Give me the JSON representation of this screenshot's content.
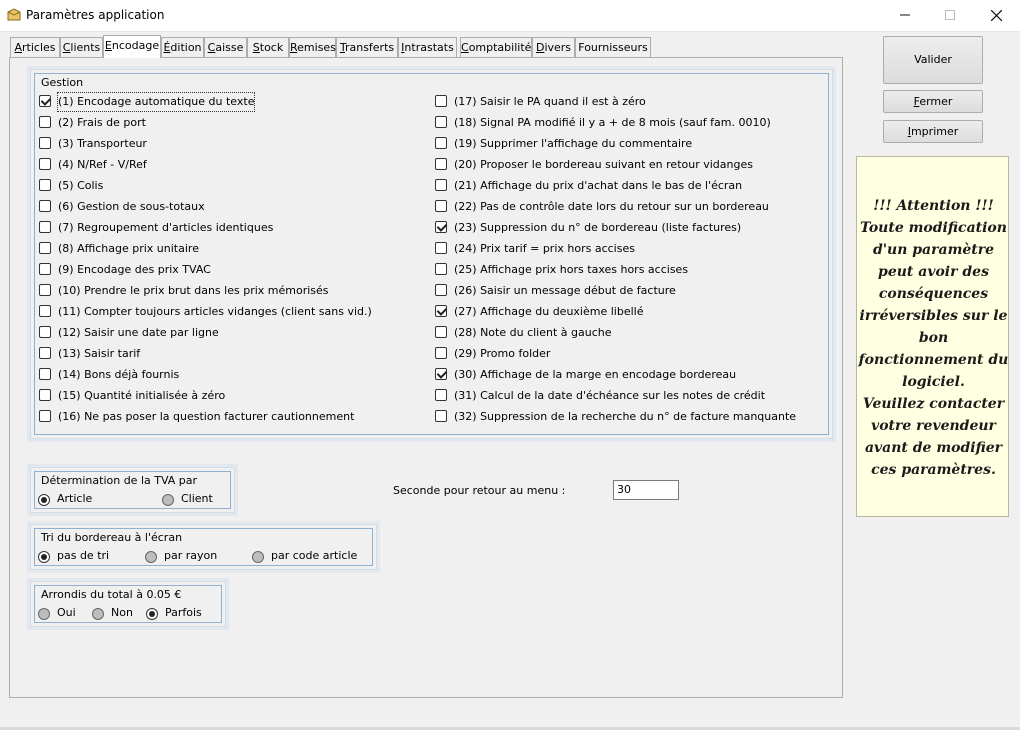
{
  "window": {
    "title": "Paramètres application"
  },
  "tabs": [
    {
      "pre": "",
      "u": "A",
      "post": "rticles"
    },
    {
      "pre": "",
      "u": "C",
      "post": "lients"
    },
    {
      "pre": "",
      "u": "E",
      "post": "ncodage"
    },
    {
      "pre": "",
      "u": "É",
      "post": "dition"
    },
    {
      "pre": "",
      "u": "C",
      "post": "aisse"
    },
    {
      "pre": "",
      "u": "S",
      "post": "tock"
    },
    {
      "pre": "",
      "u": "R",
      "post": "emises"
    },
    {
      "pre": "",
      "u": "T",
      "post": "ransferts"
    },
    {
      "pre": "",
      "u": "I",
      "post": "ntrastats"
    },
    {
      "pre": "",
      "u": "C",
      "post": "omptabilité"
    },
    {
      "pre": "",
      "u": "D",
      "post": "ivers"
    },
    {
      "pre": "",
      "u": "",
      "post": "Fournisseurs"
    }
  ],
  "gestion": {
    "title": "Gestion",
    "left": [
      {
        "label": "(1) Encodage automatique du texte",
        "checked": true
      },
      {
        "label": "(2) Frais de port",
        "checked": false
      },
      {
        "label": "(3) Transporteur",
        "checked": false
      },
      {
        "label": "(4) N/Ref - V/Ref",
        "checked": false
      },
      {
        "label": "(5) Colis",
        "checked": false
      },
      {
        "label": "(6) Gestion de sous-totaux",
        "checked": false
      },
      {
        "label": "(7) Regroupement d'articles identiques",
        "checked": false
      },
      {
        "label": "(8) Affichage prix unitaire",
        "checked": false
      },
      {
        "label": "(9) Encodage des prix TVAC",
        "checked": false
      },
      {
        "label": "(10) Prendre le prix brut dans les prix mémorisés",
        "checked": false
      },
      {
        "label": "(11) Compter toujours articles vidanges (client sans vid.)",
        "checked": false
      },
      {
        "label": "(12) Saisir une date par ligne",
        "checked": false
      },
      {
        "label": "(13) Saisir tarif",
        "checked": false
      },
      {
        "label": "(14) Bons déjà fournis",
        "checked": false
      },
      {
        "label": "(15) Quantité initialisée à zéro",
        "checked": false
      },
      {
        "label": "(16) Ne pas poser la question facturer cautionnement",
        "checked": false
      }
    ],
    "right": [
      {
        "label": "(17) Saisir le PA quand il est à zéro",
        "checked": false
      },
      {
        "label": "(18) Signal PA modifié il y a + de 8 mois (sauf fam. 0010)",
        "checked": false
      },
      {
        "label": "(19) Supprimer l'affichage du commentaire",
        "checked": false
      },
      {
        "label": "(20) Proposer le bordereau suivant en retour vidanges",
        "checked": false
      },
      {
        "label": "(21) Affichage du prix d'achat dans le bas de l'écran",
        "checked": false
      },
      {
        "label": "(22) Pas de contrôle date lors du retour sur un bordereau",
        "checked": false
      },
      {
        "label": "(23) Suppression du n° de bordereau (liste factures)",
        "checked": true
      },
      {
        "label": "(24) Prix tarif = prix hors accises",
        "checked": false
      },
      {
        "label": "(25) Affichage prix hors taxes hors accises",
        "checked": false
      },
      {
        "label": "(26) Saisir un message début de facture",
        "checked": false
      },
      {
        "label": "(27) Affichage du deuxième libellé",
        "checked": true
      },
      {
        "label": "(28) Note du client à gauche",
        "checked": false
      },
      {
        "label": "(29) Promo folder",
        "checked": false
      },
      {
        "label": "(30) Affichage de la marge en encodage bordereau",
        "checked": true
      },
      {
        "label": "(31) Calcul de la date d'échéance sur les notes de crédit",
        "checked": false
      },
      {
        "label": "(32) Suppression de la recherche du n° de facture manquante",
        "checked": false
      }
    ]
  },
  "tva": {
    "title": "Détermination de la TVA par",
    "options": [
      "Article",
      "Client"
    ],
    "selected": 0
  },
  "tri": {
    "title": "Tri du bordereau à l'écran",
    "options": [
      "pas de tri",
      "par rayon",
      "par code article"
    ],
    "selected": 0
  },
  "arrondi": {
    "title": "Arrondis du total à 0.05 €",
    "options": [
      "Oui",
      "Non",
      "Parfois"
    ],
    "selected": 2
  },
  "seconde": {
    "label": "Seconde pour retour au menu :",
    "value": "30"
  },
  "buttons": {
    "valider": "Valider",
    "fermer": {
      "u": "F",
      "rest": "ermer"
    },
    "imprimer": {
      "u": "I",
      "rest": "mprimer"
    }
  },
  "warning": [
    "!!! Attention !!!",
    "Toute modification",
    "d'un paramètre",
    "peut avoir des",
    "conséquences",
    "irréversibles sur le",
    "bon",
    "fonctionnement du",
    "logiciel.",
    "Veuillez contacter",
    "votre revendeur",
    "avant de modifier",
    "ces paramètres."
  ],
  "colors": {
    "accent": "#8fb0d0",
    "warning_bg": "#ffffe1"
  }
}
